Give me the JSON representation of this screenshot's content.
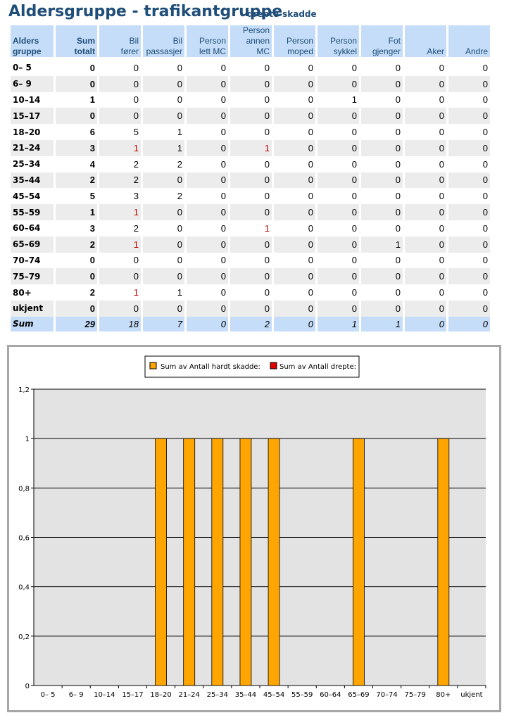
{
  "header": {
    "title": "Aldersgruppe - trafikantgruppe",
    "subtitle": "drepte-skadde"
  },
  "table": {
    "columns": [
      "Alders gruppe",
      "Sum totalt",
      "Bil fører",
      "Bil passasjer",
      "Person lett MC",
      "Person annen MC",
      "Person moped",
      "Person sykkel",
      "Fot gjenger",
      "Aker",
      "Andre"
    ],
    "rows": [
      {
        "label": "0– 5",
        "values": [
          0,
          0,
          0,
          0,
          0,
          0,
          0,
          0,
          0,
          0
        ],
        "red": []
      },
      {
        "label": "6– 9",
        "values": [
          0,
          0,
          0,
          0,
          0,
          0,
          0,
          0,
          0,
          0
        ],
        "red": []
      },
      {
        "label": "10–14",
        "values": [
          1,
          0,
          0,
          0,
          0,
          0,
          1,
          0,
          0,
          0
        ],
        "red": []
      },
      {
        "label": "15–17",
        "values": [
          0,
          0,
          0,
          0,
          0,
          0,
          0,
          0,
          0,
          0
        ],
        "red": []
      },
      {
        "label": "18–20",
        "values": [
          6,
          5,
          1,
          0,
          0,
          0,
          0,
          0,
          0,
          0
        ],
        "red": []
      },
      {
        "label": "21–24",
        "values": [
          3,
          1,
          1,
          0,
          1,
          0,
          0,
          0,
          0,
          0
        ],
        "red": [
          1,
          4
        ]
      },
      {
        "label": "25–34",
        "values": [
          4,
          2,
          2,
          0,
          0,
          0,
          0,
          0,
          0,
          0
        ],
        "red": []
      },
      {
        "label": "35–44",
        "values": [
          2,
          2,
          0,
          0,
          0,
          0,
          0,
          0,
          0,
          0
        ],
        "red": []
      },
      {
        "label": "45–54",
        "values": [
          5,
          3,
          2,
          0,
          0,
          0,
          0,
          0,
          0,
          0
        ],
        "red": []
      },
      {
        "label": "55–59",
        "values": [
          1,
          1,
          0,
          0,
          0,
          0,
          0,
          0,
          0,
          0
        ],
        "red": [
          1
        ]
      },
      {
        "label": "60–64",
        "values": [
          3,
          2,
          0,
          0,
          1,
          0,
          0,
          0,
          0,
          0
        ],
        "red": [
          4
        ]
      },
      {
        "label": "65–69",
        "values": [
          2,
          1,
          0,
          0,
          0,
          0,
          0,
          1,
          0,
          0
        ],
        "red": [
          1
        ]
      },
      {
        "label": "70–74",
        "values": [
          0,
          0,
          0,
          0,
          0,
          0,
          0,
          0,
          0,
          0
        ],
        "red": []
      },
      {
        "label": "75–79",
        "values": [
          0,
          0,
          0,
          0,
          0,
          0,
          0,
          0,
          0,
          0
        ],
        "red": []
      },
      {
        "label": "80+",
        "values": [
          2,
          1,
          1,
          0,
          0,
          0,
          0,
          0,
          0,
          0
        ],
        "red": [
          1
        ]
      },
      {
        "label": "ukjent",
        "values": [
          0,
          0,
          0,
          0,
          0,
          0,
          0,
          0,
          0,
          0
        ],
        "red": []
      }
    ],
    "sum": {
      "label": "Sum",
      "values": [
        29,
        18,
        7,
        0,
        2,
        0,
        1,
        1,
        0,
        0
      ]
    }
  },
  "chart_data": {
    "type": "bar",
    "categories": [
      "0– 5",
      "6– 9",
      "10–14",
      "15–17",
      "18–20",
      "21–24",
      "25–34",
      "35–44",
      "45–54",
      "55–59",
      "60–64",
      "65–69",
      "70–74",
      "75–79",
      "80+",
      "ukjent"
    ],
    "series": [
      {
        "name": "Sum av Antall hardt skadde:",
        "color": "#ffa500",
        "values": [
          0,
          0,
          0,
          0,
          1,
          1,
          1,
          1,
          1,
          0,
          0,
          1,
          0,
          0,
          1,
          0
        ]
      },
      {
        "name": "Sum av Antall drepte:",
        "color": "#e00000",
        "values": [
          0,
          0,
          0,
          0,
          0,
          0,
          0,
          0,
          0,
          0,
          0,
          0,
          0,
          0,
          0,
          0
        ]
      }
    ],
    "ylim": [
      0,
      1.2
    ],
    "yticks": [
      "0",
      "0,2",
      "0,4",
      "0,6",
      "0,8",
      "1",
      "1,2"
    ],
    "grid": true,
    "legend": "top"
  }
}
